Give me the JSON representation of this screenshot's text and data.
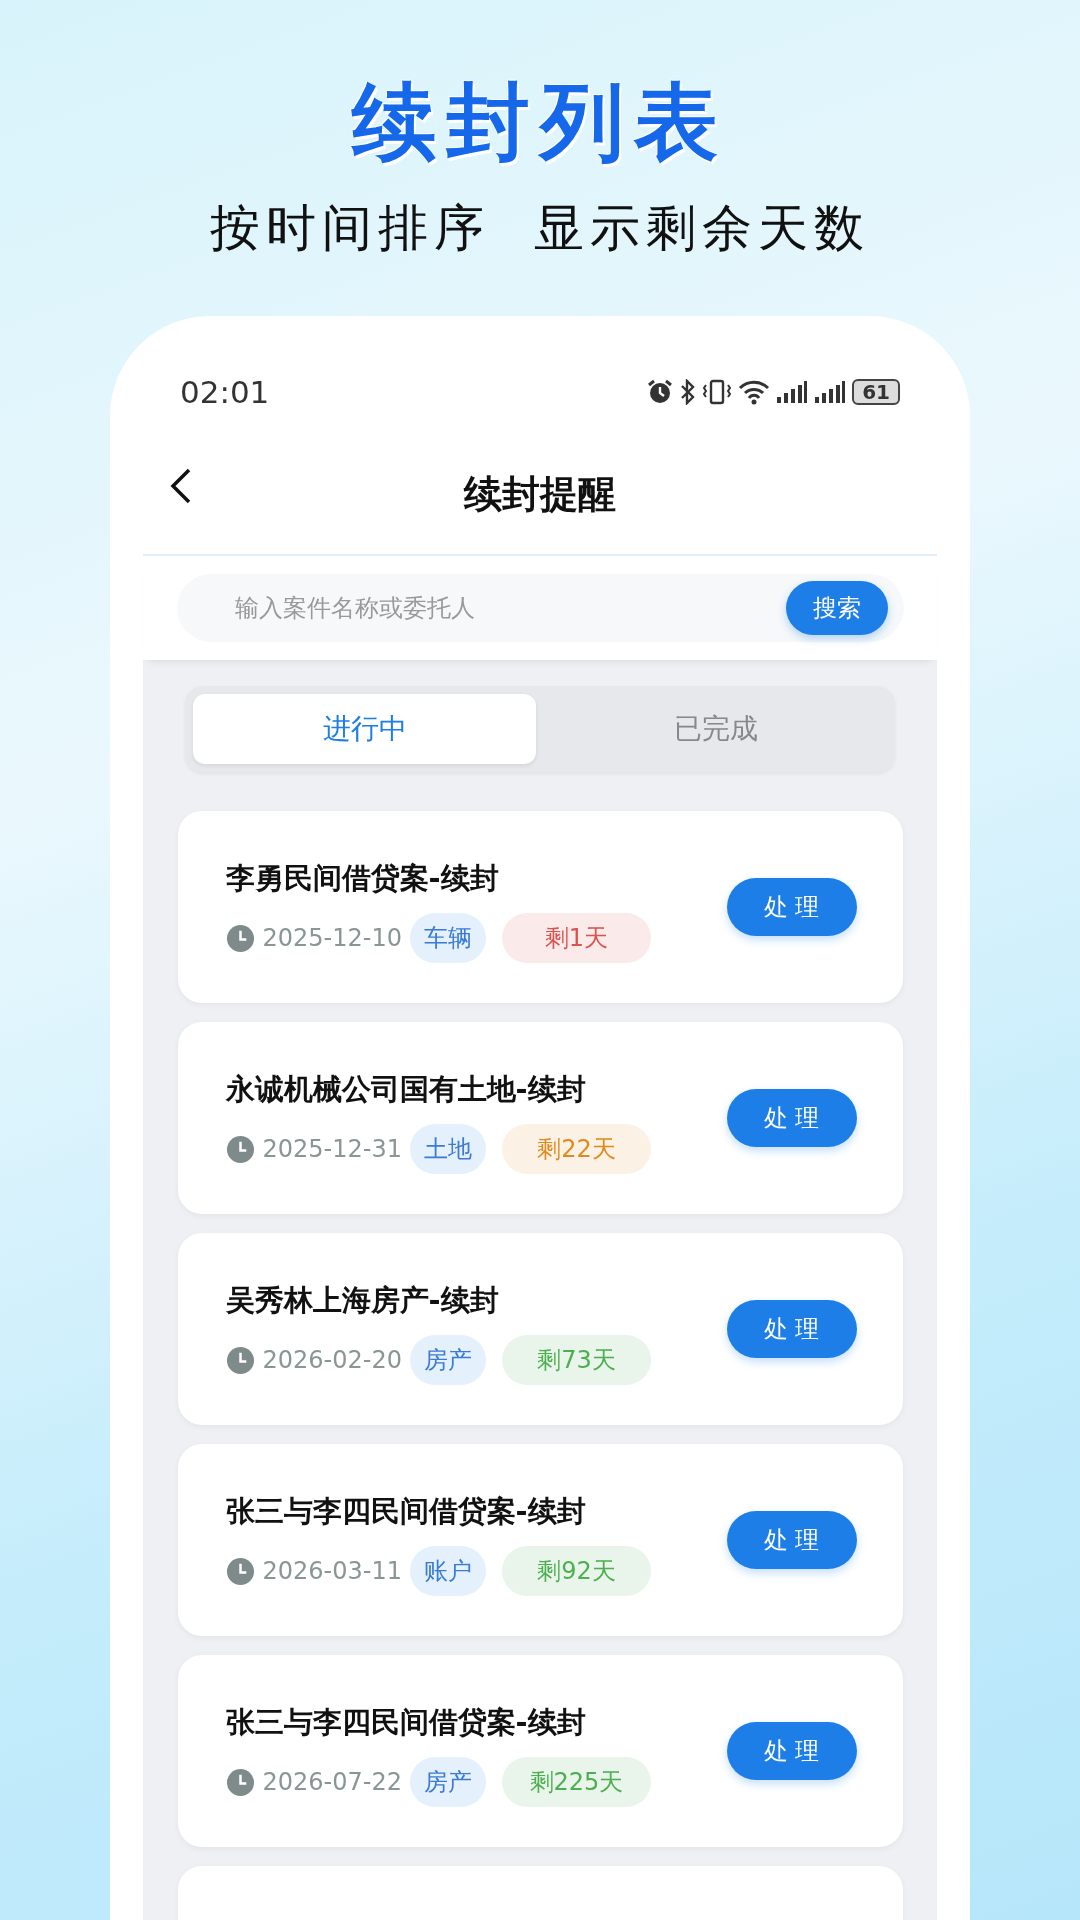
{
  "headline": "续封列表",
  "subheadline": "按时间排序  显示剩余天数",
  "status_bar": {
    "time": "02:01",
    "battery": "61"
  },
  "nav": {
    "title": "续封提醒"
  },
  "search": {
    "placeholder": "输入案件名称或委托人",
    "button": "搜索"
  },
  "tabs": [
    {
      "label": "进行中",
      "selected": true
    },
    {
      "label": "已完成",
      "selected": false
    }
  ],
  "items": [
    {
      "title": "李勇民间借贷案-续封",
      "date": "2025-12-10",
      "tag": "车辆",
      "remaining": "剩1天",
      "color": "#d9534f",
      "action": "处 理"
    },
    {
      "title": "永诚机械公司国有土地-续封",
      "date": "2025-12-31",
      "tag": "土地",
      "remaining": "剩22天",
      "color": "#e08a1e",
      "action": "处 理"
    },
    {
      "title": "吴秀林上海房产-续封",
      "date": "2026-02-20",
      "tag": "房产",
      "remaining": "剩73天",
      "color": "#4caf50",
      "action": "处 理"
    },
    {
      "title": "张三与李四民间借贷案-续封",
      "date": "2026-03-11",
      "tag": "账户",
      "remaining": "剩92天",
      "color": "#4caf50",
      "action": "处 理"
    },
    {
      "title": "张三与李四民间借贷案-续封",
      "date": "2026-07-22",
      "tag": "房产",
      "remaining": "剩225天",
      "color": "#4caf50",
      "action": "处 理"
    }
  ],
  "partial_card": {
    "kind": "card"
  }
}
